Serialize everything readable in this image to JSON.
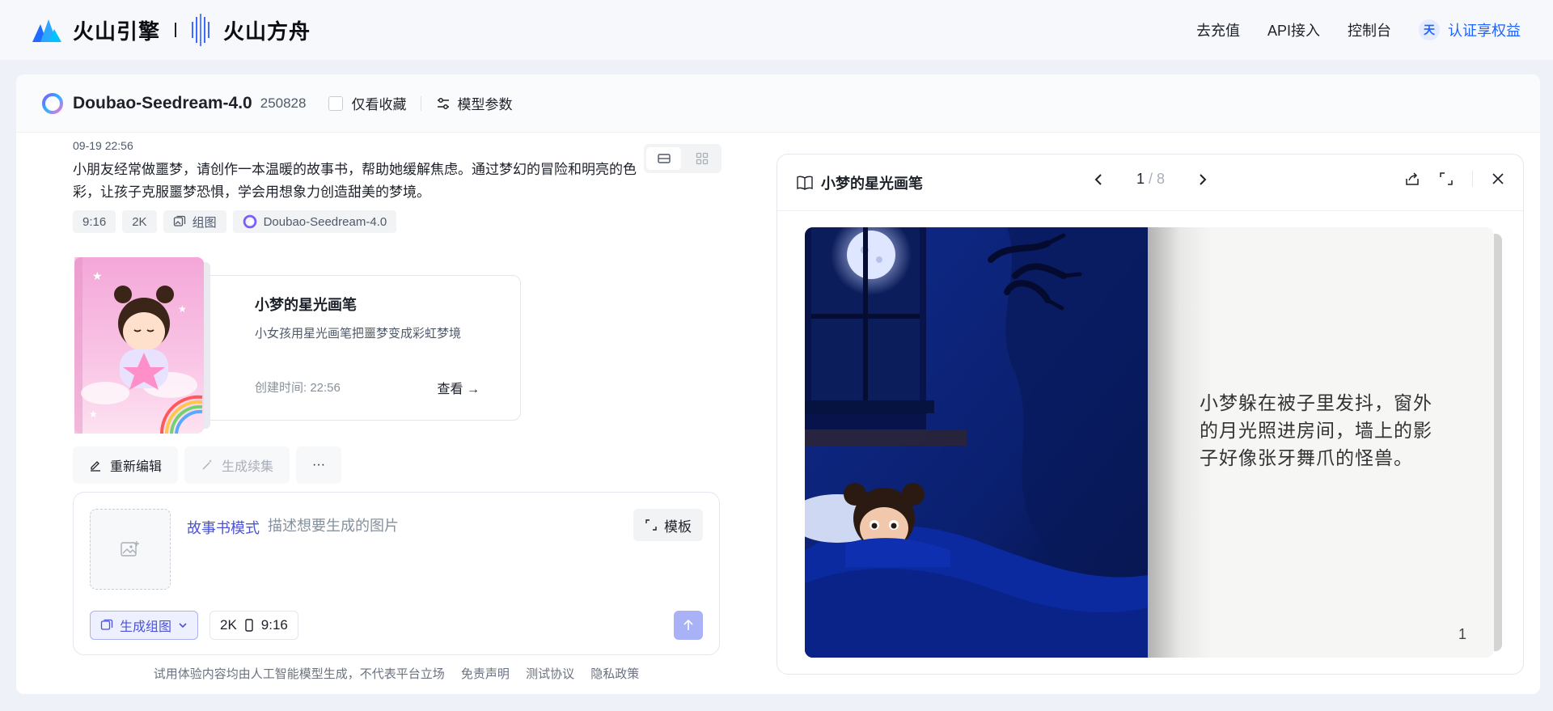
{
  "header": {
    "brand_primary": "火山引擎",
    "brand_secondary": "火山方舟",
    "nav": [
      "去充值",
      "API接入",
      "控制台"
    ],
    "auth_avatar": "天",
    "auth_label": "认证享权益"
  },
  "model_bar": {
    "name": "Doubao-Seedream-4.0",
    "version": "250828",
    "favorites_label": "仅看收藏",
    "params_label": "模型参数"
  },
  "conversation": {
    "timestamp": "09-19 22:56",
    "prompt": "小朋友经常做噩梦，请创作一本温暖的故事书，帮助她缓解焦虑。通过梦幻的冒险和明亮的色彩，让孩子克服噩梦恐惧，学会用想象力创造甜美的梦境。",
    "tags": {
      "ratio": "9:16",
      "resolution": "2K",
      "type": "组图",
      "model": "Doubao-Seedream-4.0"
    }
  },
  "book_card": {
    "title": "小梦的星光画笔",
    "subtitle": "小女孩用星光画笔把噩梦变成彩虹梦境",
    "created": "创建时间: 22:56",
    "view_label": "查看"
  },
  "actions": {
    "edit": "重新编辑",
    "continue": "生成续集",
    "more": "···"
  },
  "composer": {
    "mode": "故事书模式",
    "placeholder": "描述想要生成的图片",
    "template": "模板",
    "gen_type": "生成组图",
    "resolution": "2K",
    "ratio": "9:16"
  },
  "footer": {
    "disclaimer": "试用体验内容均由人工智能模型生成，不代表平台立场",
    "links": [
      "免责声明",
      "测试协议",
      "隐私政策"
    ]
  },
  "reader": {
    "title": "小梦的星光画笔",
    "current_page": "1",
    "total_pages": "/ 8",
    "page_text": "小梦躲在被子里发抖，窗外的月光照进房间，墙上的影子好像张牙舞爪的怪兽。",
    "page_number": "1"
  },
  "colors": {
    "accent": "#4b53d6",
    "link": "#1d63ff",
    "send_disabled": "#a9b2f6"
  }
}
